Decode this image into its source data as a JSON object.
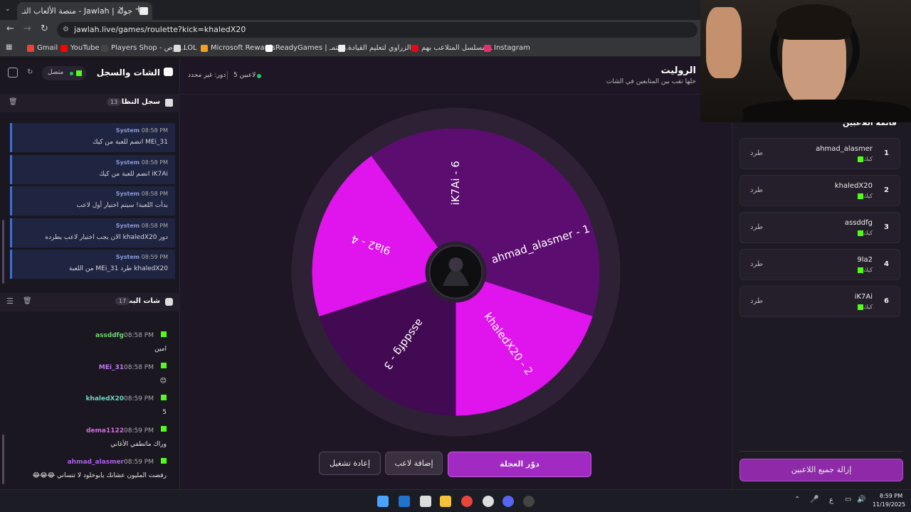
{
  "browser": {
    "tab_title": "جولة | Jawlah - منصة الألعاب التـ",
    "new_tab": "+",
    "url": "jawlah.live/games/roulette?kick=khaledX20",
    "bookmarks": [
      "Gmail",
      "YouTube",
      "Players Shop - توص...",
      "LOL",
      "Microsoft Rewards",
      "ReadyGames | مُجتمـ...",
      "الزراوي لتعليم القيادة...",
      "مسلسل المتلاعب بهم...",
      "Instagram"
    ],
    "bookmark_colors": [
      "#ea4335",
      "#ff0000",
      "#444",
      "#ddd",
      "#f3a11a",
      "#fff",
      "#eee",
      "#e50914",
      "#e1306c"
    ]
  },
  "left_panel": {
    "title": "الشات والسجل",
    "status": "متصل",
    "system_log": {
      "title": "سجل النظام",
      "count": "13",
      "messages": [
        {
          "author": "System",
          "time": "08:58 PM",
          "text": "MEi_31 انضم للعبة من كيك"
        },
        {
          "author": "System",
          "time": "08:58 PM",
          "text": "iK7Ai انضم للعبة من كيك"
        },
        {
          "author": "System",
          "time": "08:58 PM",
          "text": "بدأت اللعبة! سيتم اختيار أول لاعب"
        },
        {
          "author": "System",
          "time": "08:58 PM",
          "text": "دور khaledX20 الان يجب اختيار لاعب يطرده"
        },
        {
          "author": "System",
          "time": "08:59 PM",
          "text": "khaledX20 طرد MEi_31 من اللعبة"
        }
      ]
    },
    "stream_chat": {
      "title": "شات البث",
      "count": "17",
      "messages": [
        {
          "user": "assddfg",
          "time": "08:58 PM",
          "text": "امين",
          "color": "#6fd66f"
        },
        {
          "user": "MEi_31",
          "time": "08:58 PM",
          "text": "😊",
          "color": "#c07cf0"
        },
        {
          "user": "khaledX20",
          "time": "08:59 PM",
          "text": "5",
          "color": "#6fd6c6"
        },
        {
          "user": "dema1122",
          "time": "08:59 PM",
          "text": "وراك ماتطفي الأغاني",
          "color": "#d06fe0"
        },
        {
          "user": "ahmad_alasmer",
          "time": "08:59 PM",
          "text": "رفضت المليون عشانك يابوخلود لا تنساني 😂😂😂",
          "color": "#b05ff0"
        }
      ]
    }
  },
  "game": {
    "title": "الروليت",
    "subtitle": "خلها تقب بين المتابعين في الشات",
    "player_count": "5 لاعبين",
    "turn": "دور: غير محدد",
    "buttons": {
      "spin": "دوّر العجلة",
      "add": "إضافة لاعب",
      "reset": "إعادة تشغيل"
    }
  },
  "chart_data": {
    "type": "pie",
    "categories": [
      "ahmad_alasmer - 1",
      "khaledX20 - 2",
      "assddfg - 3",
      "9la2 - 4",
      "iK7Ai - 6"
    ],
    "values": [
      1,
      1,
      1,
      1,
      1
    ],
    "colors": [
      "#5c0d70",
      "#e014ec",
      "#420a52",
      "#e014ec",
      "#5c0d70"
    ]
  },
  "players_panel": {
    "title": "قائمة اللاعبين",
    "kick_label": "طرد",
    "source": "كيك",
    "players": [
      {
        "index": "1",
        "name": "ahmad_alasmer"
      },
      {
        "index": "2",
        "name": "khaledX20"
      },
      {
        "index": "3",
        "name": "assddfg"
      },
      {
        "index": "4",
        "name": "9la2"
      },
      {
        "index": "6",
        "name": "iK7Ai"
      }
    ],
    "clear_all": "إزالة جميع اللاعبين"
  },
  "taskbar": {
    "time": "8:59 PM",
    "date": "11/19/2025",
    "lang": "ع"
  }
}
